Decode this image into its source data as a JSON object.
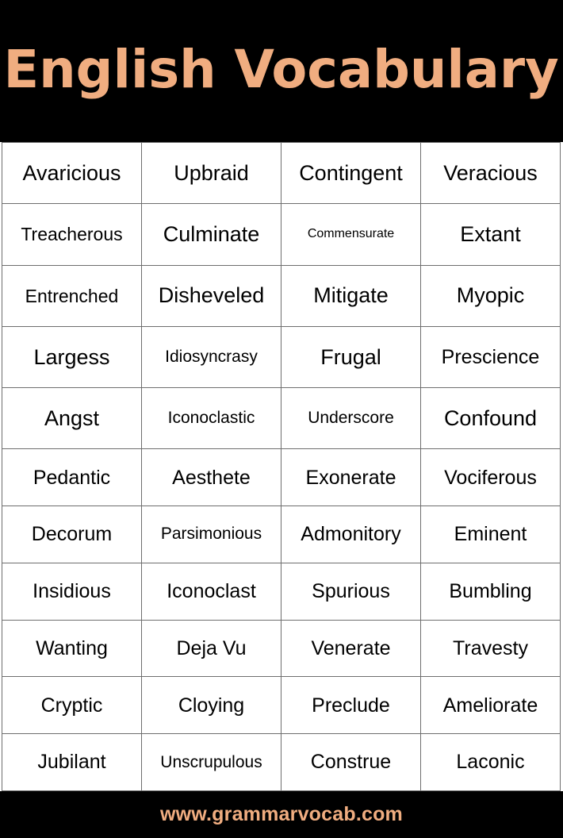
{
  "header": {
    "title": "English Vocabulary",
    "background_color": "#000000",
    "text_color": "#f0ad80"
  },
  "footer": {
    "url": "www.grammarvocab.com",
    "background_color": "#000000",
    "text_color": "#f0ad80"
  },
  "table": {
    "columns": 4,
    "rows_count": 11,
    "border_color": "#6e6e6e",
    "background_color": "#ffffff",
    "text_color": "#000000",
    "rows": [
      [
        {
          "word": "Avaricious",
          "size": "s28"
        },
        {
          "word": "Upbraid",
          "size": "s28"
        },
        {
          "word": "Contingent",
          "size": "s28"
        },
        {
          "word": "Veracious",
          "size": "s28"
        }
      ],
      [
        {
          "word": "Treacherous",
          "size": "s24"
        },
        {
          "word": "Culminate",
          "size": "s28"
        },
        {
          "word": "Commensurate",
          "size": "s16"
        },
        {
          "word": "Extant",
          "size": "s28"
        }
      ],
      [
        {
          "word": "Entrenched",
          "size": "s24"
        },
        {
          "word": "Disheveled",
          "size": "s28"
        },
        {
          "word": "Mitigate",
          "size": "s28"
        },
        {
          "word": "Myopic",
          "size": "s28"
        }
      ],
      [
        {
          "word": "Largess",
          "size": "s28"
        },
        {
          "word": "Idiosyncrasy",
          "size": "s22"
        },
        {
          "word": "Frugal",
          "size": "s28"
        },
        {
          "word": "Prescience",
          "size": "s26"
        }
      ],
      [
        {
          "word": "Angst",
          "size": "s28"
        },
        {
          "word": "Iconoclastic",
          "size": "s22"
        },
        {
          "word": "Underscore",
          "size": "s22"
        },
        {
          "word": "Confound",
          "size": "s28"
        }
      ],
      [
        {
          "word": "Pedantic",
          "size": "s26"
        },
        {
          "word": "Aesthete",
          "size": "s26"
        },
        {
          "word": "Exonerate",
          "size": "s26"
        },
        {
          "word": "Vociferous",
          "size": "s26"
        }
      ],
      [
        {
          "word": "Decorum",
          "size": "s26"
        },
        {
          "word": "Parsimonious",
          "size": "s22"
        },
        {
          "word": "Admonitory",
          "size": "s26"
        },
        {
          "word": "Eminent",
          "size": "s26"
        }
      ],
      [
        {
          "word": "Insidious",
          "size": "s26"
        },
        {
          "word": "Iconoclast",
          "size": "s26"
        },
        {
          "word": "Spurious",
          "size": "s26"
        },
        {
          "word": "Bumbling",
          "size": "s26"
        }
      ],
      [
        {
          "word": "Wanting",
          "size": "s26"
        },
        {
          "word": "Deja Vu",
          "size": "s26"
        },
        {
          "word": "Venerate",
          "size": "s26"
        },
        {
          "word": "Travesty",
          "size": "s26"
        }
      ],
      [
        {
          "word": "Cryptic",
          "size": "s26"
        },
        {
          "word": "Cloying",
          "size": "s26"
        },
        {
          "word": "Preclude",
          "size": "s26"
        },
        {
          "word": "Ameliorate",
          "size": "s26"
        }
      ],
      [
        {
          "word": "Jubilant",
          "size": "s26"
        },
        {
          "word": "Unscrupulous",
          "size": "s22"
        },
        {
          "word": "Construe",
          "size": "s26"
        },
        {
          "word": "Laconic",
          "size": "s26"
        }
      ]
    ]
  }
}
